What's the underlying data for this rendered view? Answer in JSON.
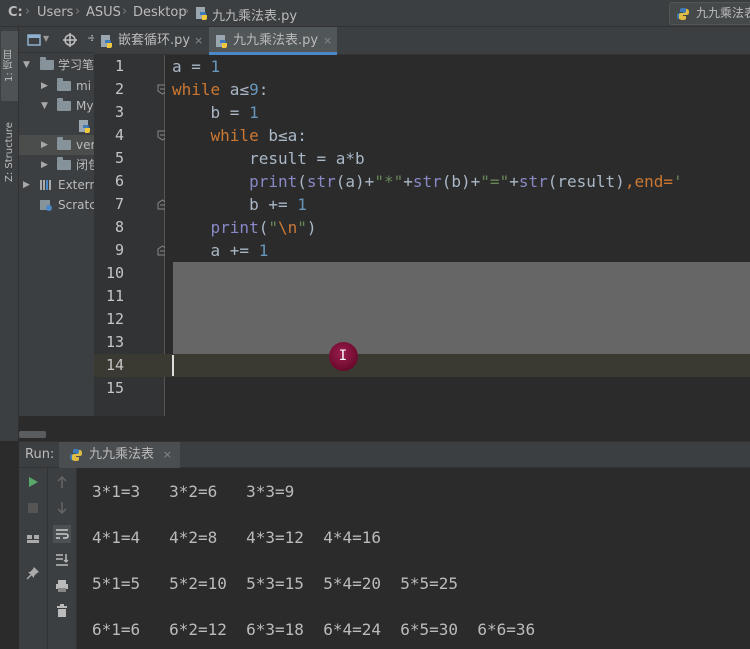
{
  "breadcrumb": {
    "drive": "C:",
    "items": [
      "Users",
      "ASUS",
      "Desktop",
      "九九乘法表.py"
    ]
  },
  "run_config": {
    "label": "九九乘法表"
  },
  "left_strip": {
    "project_tab": "1: 项目",
    "structure_tab": "Z: Structure"
  },
  "project_tree": {
    "items": [
      {
        "label": "学习笔",
        "arrow": "▼"
      },
      {
        "label": "mi",
        "arrow": "▶"
      },
      {
        "label": "My",
        "arrow": "▼"
      },
      {
        "label": "",
        "arrow": ""
      },
      {
        "label": "ver",
        "arrow": "▶"
      },
      {
        "label": "闭包",
        "arrow": "▶"
      },
      {
        "label": "Extern",
        "arrow": "▶"
      },
      {
        "label": "Scratc",
        "arrow": ""
      }
    ]
  },
  "editor_tabs": [
    {
      "label": "嵌套循环.py",
      "close": "×"
    },
    {
      "label": "九九乘法表.py",
      "close": "×"
    }
  ],
  "line_numbers": [
    "1",
    "2",
    "3",
    "4",
    "5",
    "6",
    "7",
    "8",
    "9",
    "10",
    "11",
    "12",
    "13",
    "14",
    "15"
  ],
  "code": {
    "l1": {
      "a": "a = ",
      "b": "1"
    },
    "l2": {
      "a": "while",
      "b": " a≤",
      "c": "9",
      "d": ":"
    },
    "l3": {
      "a": "    b = ",
      "b": "1"
    },
    "l4": {
      "a": "    ",
      "b": "while",
      "c": " b≤a:"
    },
    "l5": {
      "a": "        result = a*b"
    },
    "l6": {
      "a": "        ",
      "b": "print",
      "c": "(",
      "d": "str",
      "e": "(a)+",
      "f": "\"*\"",
      "g": "+",
      "h": "str",
      "i": "(b)+",
      "j": "\"=\"",
      "k": "+",
      "l": "str",
      "m": "(result)",
      "n": ",end=",
      "o": "'"
    },
    "l7": {
      "a": "        b += ",
      "b": "1"
    },
    "l8": {
      "a": "    ",
      "b": "print",
      "c": "(",
      "d": "\"",
      "e": "\\n",
      "f": "\"",
      "g": ")"
    },
    "l9": {
      "a": "    a += ",
      "b": "1"
    }
  },
  "cursor_glyph": "I",
  "run_panel": {
    "label": "Run:",
    "tab_label": "九九乘法表",
    "tab_close": "×",
    "output": [
      "3*1=3   3*2=6   3*3=9",
      "4*1=4   4*2=8   4*3=12  4*4=16",
      "5*1=5   5*2=10  5*3=15  5*4=20  5*5=25",
      "6*1=6   6*2=12  6*3=18  6*4=24  6*5=30  6*6=36"
    ]
  },
  "colors": {
    "keyword": "#cc7832",
    "number": "#6897bb",
    "builtin": "#8888c6",
    "string": "#6a8759",
    "run_green": "#59a869"
  }
}
